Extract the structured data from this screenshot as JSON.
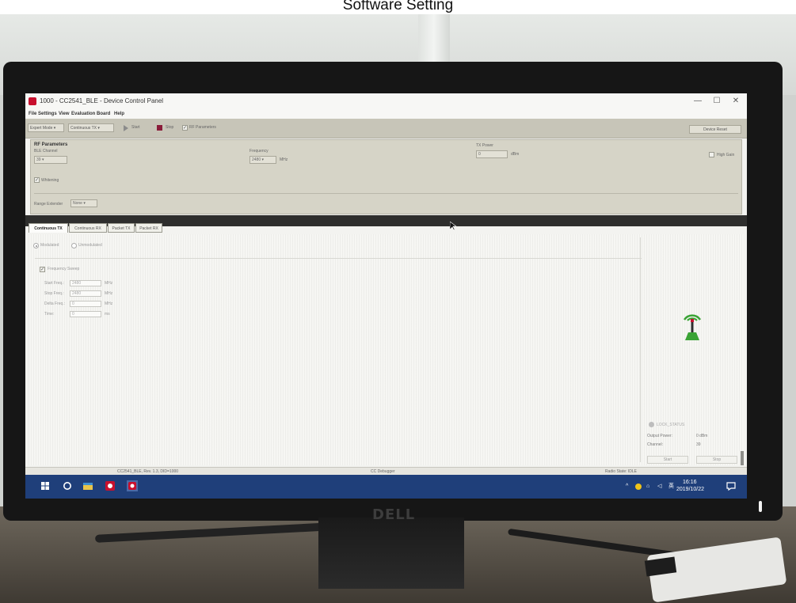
{
  "photo": {
    "caption": "Software Setting",
    "monitor_brand": "DELL"
  },
  "window": {
    "title": "1000 - CC2541_BLE - Device Control Panel",
    "controls": {
      "minimize": "—",
      "maximize": "☐",
      "close": "✕"
    }
  },
  "menu": [
    "File",
    "Settings",
    "View",
    "Evaluation Board",
    "Help"
  ],
  "toolbar": {
    "mode_select": "Expert Mode",
    "test_select": "Continuous TX",
    "start_label": "Start",
    "stop_label": "Stop",
    "rf_parameters_label": "RF Parameters",
    "rf_parameters_checked": true,
    "device_reset_label": "Device Reset"
  },
  "rf_parameters": {
    "title": "RF Parameters",
    "ble_channel_label": "BLE Channel",
    "ble_channel_value": "39",
    "frequency_label": "Frequency",
    "frequency_value": "2480",
    "frequency_unit": "MHz",
    "tx_power_label": "TX Power",
    "tx_power_value": "0",
    "tx_power_unit": "dBm",
    "high_gain_label": "High Gain",
    "whitening_label": "Whitening",
    "whitening_checked": true,
    "range_extender_label": "Range Extender",
    "range_extender_value": "None"
  },
  "tabs": [
    {
      "label": "Continuous TX",
      "active": true
    },
    {
      "label": "Continuous RX",
      "active": false
    },
    {
      "label": "Packet TX",
      "active": false
    },
    {
      "label": "Packet RX",
      "active": false
    }
  ],
  "continuous_tx": {
    "modulated_label": "Modulated",
    "unmodulated_label": "Unmodulated",
    "frequency_sweep_label": "Frequency Sweep",
    "fields": [
      {
        "label": "Start Freq.:",
        "value": "2480",
        "unit": "MHz"
      },
      {
        "label": "Stop Freq.:",
        "value": "2480",
        "unit": "MHz"
      },
      {
        "label": "Delta Freq.:",
        "value": "0",
        "unit": "MHz"
      },
      {
        "label": "Time:",
        "value": "0",
        "unit": "ms"
      }
    ],
    "status_panel": {
      "lock_status_label": "LOCK_STATUS",
      "output_power_label": "Output Power:",
      "output_power_value": "0 dBm",
      "channel_label": "Channel:",
      "channel_value": "39",
      "start_label": "Start",
      "stop_label": "Stop"
    }
  },
  "statusbar": {
    "left": "CC2541_BLE, Rev. 1.3, DID=1000",
    "center": "CC Debugger",
    "right": "Radio State: IDLE"
  },
  "taskbar": {
    "time": "16:16",
    "date": "2019/10/22",
    "ime": "英"
  },
  "colors": {
    "toolbar_bg": "#c7c5b8",
    "taskbar_bg": "#1f3f7a",
    "app_icon_red": "#c8102e",
    "antenna_green": "#3aa335"
  }
}
